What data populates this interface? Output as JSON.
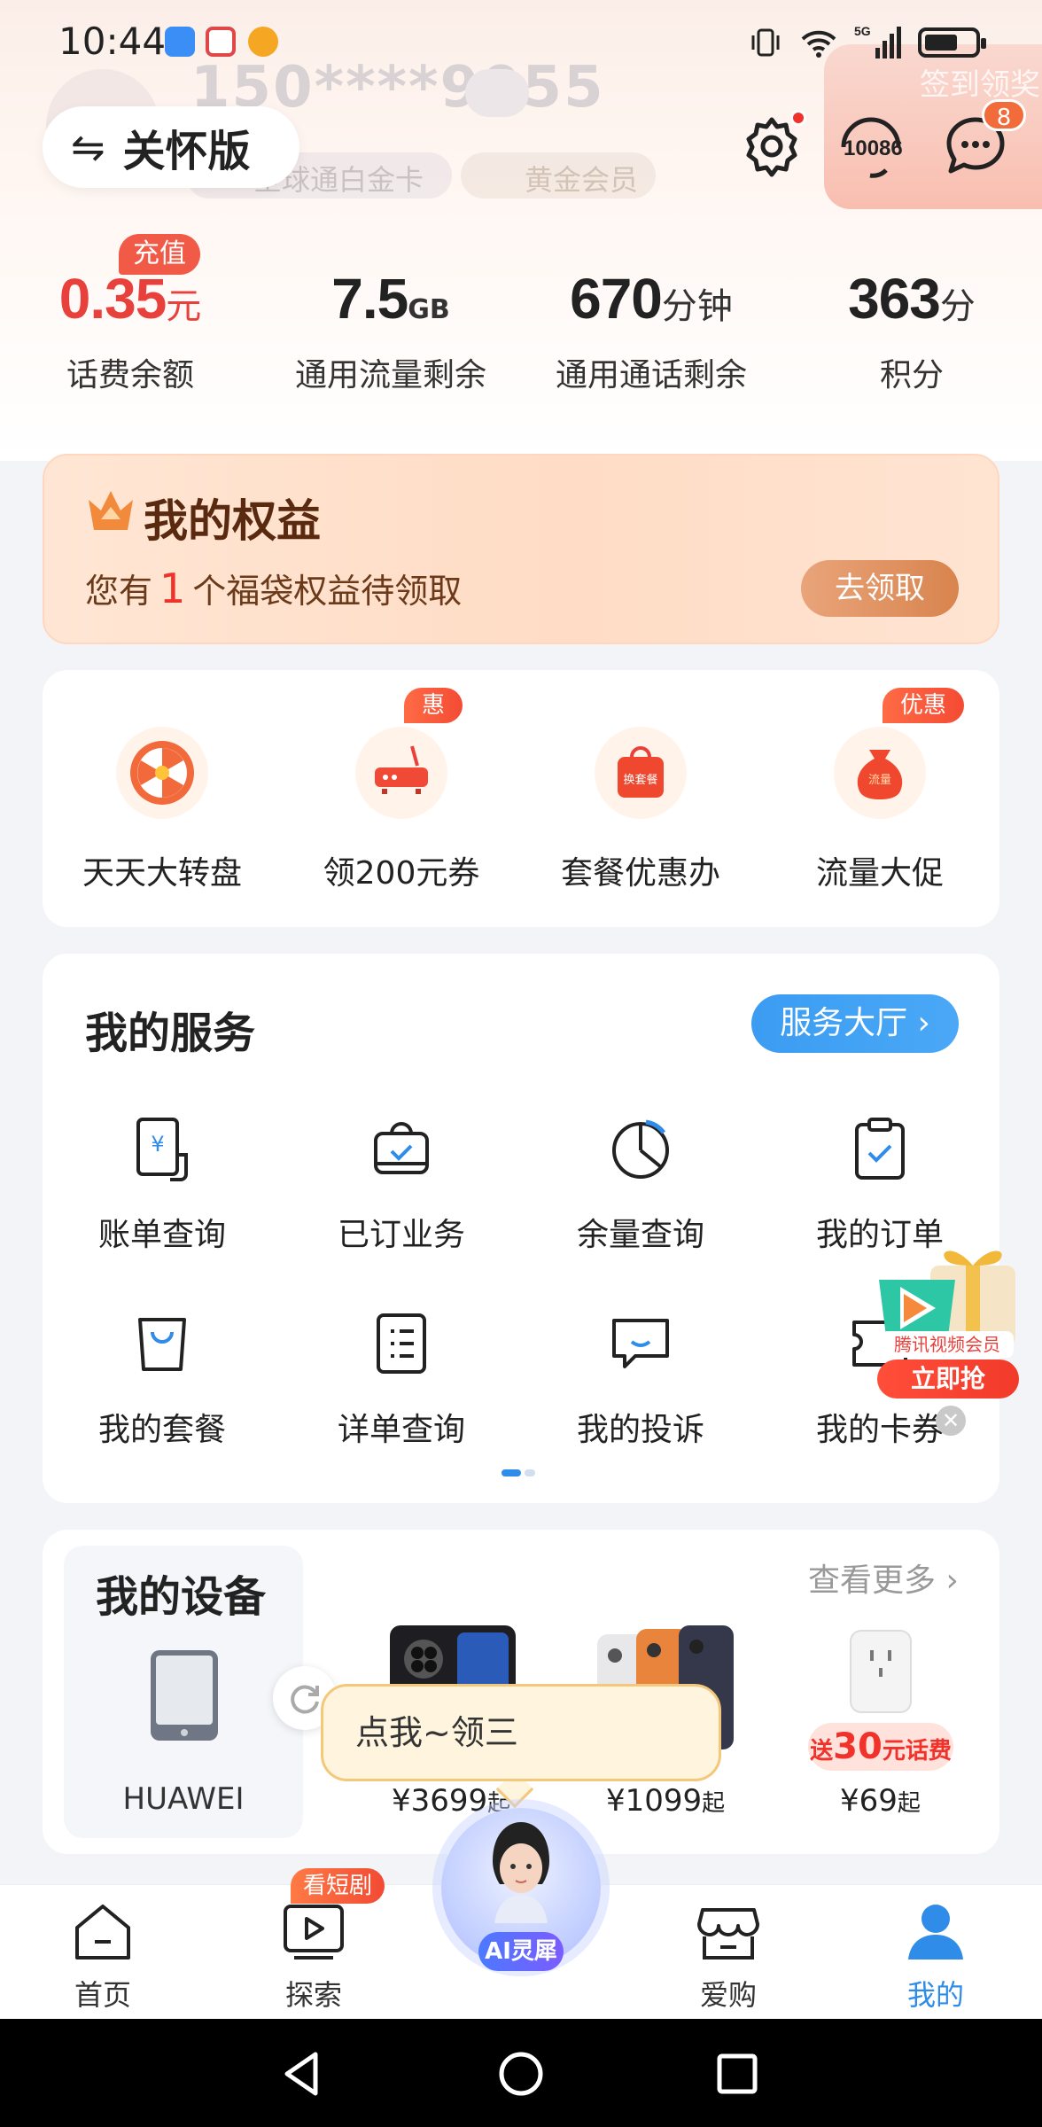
{
  "status_bar": {
    "time": "10:44"
  },
  "header": {
    "ghost_phone": "150****9055",
    "ghost_badge_1": "全球通白金卡",
    "ghost_badge_2": "黄金会员",
    "ghost_checkin": "签到领奖",
    "care_mode_label": "关怀版",
    "hotline_label": "10086",
    "message_count": "8"
  },
  "stats": [
    {
      "value": "0.35",
      "unit": "元",
      "label": "话费余额"
    },
    {
      "value": "7.5",
      "unit": "GB",
      "label": "通用流量剩余"
    },
    {
      "value": "670",
      "unit": "分钟",
      "label": "通用通话剩余"
    },
    {
      "value": "363",
      "unit": "分",
      "label": "积分"
    }
  ],
  "recharge_tag": "充值",
  "benefits": {
    "title": "我的权益",
    "desc_prefix": "您有",
    "count": "1",
    "desc_suffix": "个福袋权益待领取",
    "button": "去领取"
  },
  "promos": [
    {
      "label": "天天大转盘",
      "tag": ""
    },
    {
      "label": "领200元券",
      "tag": "惠"
    },
    {
      "label": "套餐优惠办",
      "tag": "",
      "icon_text": "换套餐"
    },
    {
      "label": "流量大促",
      "tag": "优惠",
      "icon_text": "流量"
    }
  ],
  "services": {
    "title": "我的服务",
    "hall_button": "服务大厅 ›",
    "items": [
      {
        "label": "账单查询",
        "icon": "bill-icon"
      },
      {
        "label": "已订业务",
        "icon": "subscribed-icon"
      },
      {
        "label": "余量查询",
        "icon": "balance-pie-icon"
      },
      {
        "label": "我的订单",
        "icon": "order-clipboard-icon"
      },
      {
        "label": "我的套餐",
        "icon": "bag-icon"
      },
      {
        "label": "详单查询",
        "icon": "list-doc-icon"
      },
      {
        "label": "我的投诉",
        "icon": "complaint-chat-icon"
      },
      {
        "label": "我的卡券",
        "icon": "coupon-icon"
      }
    ]
  },
  "video_promo": {
    "brand": "腾讯视频会员",
    "cta": "立即抢"
  },
  "devices": {
    "title": "我的设备",
    "more": "查看更多 ›",
    "my_device": "HUAWEI",
    "products": [
      {
        "price": "¥3699",
        "suffix": "起"
      },
      {
        "price": "¥1099",
        "suffix": "起"
      },
      {
        "price": "¥69",
        "suffix": "起",
        "tag_prefix": "送",
        "tag_num": "30",
        "tag_suffix": "元话费"
      }
    ],
    "bubble": "点我~领三"
  },
  "bottom_nav": {
    "items": [
      {
        "label": "首页"
      },
      {
        "label": "探索"
      },
      {
        "label": "爱购"
      },
      {
        "label": "我的"
      }
    ],
    "short_drama_tag": "看短剧",
    "ai_label": "AI灵犀"
  },
  "colors": {
    "accent_blue": "#2f8ce8",
    "accent_red": "#e8413c",
    "benefit_brown": "#5a2a10"
  }
}
